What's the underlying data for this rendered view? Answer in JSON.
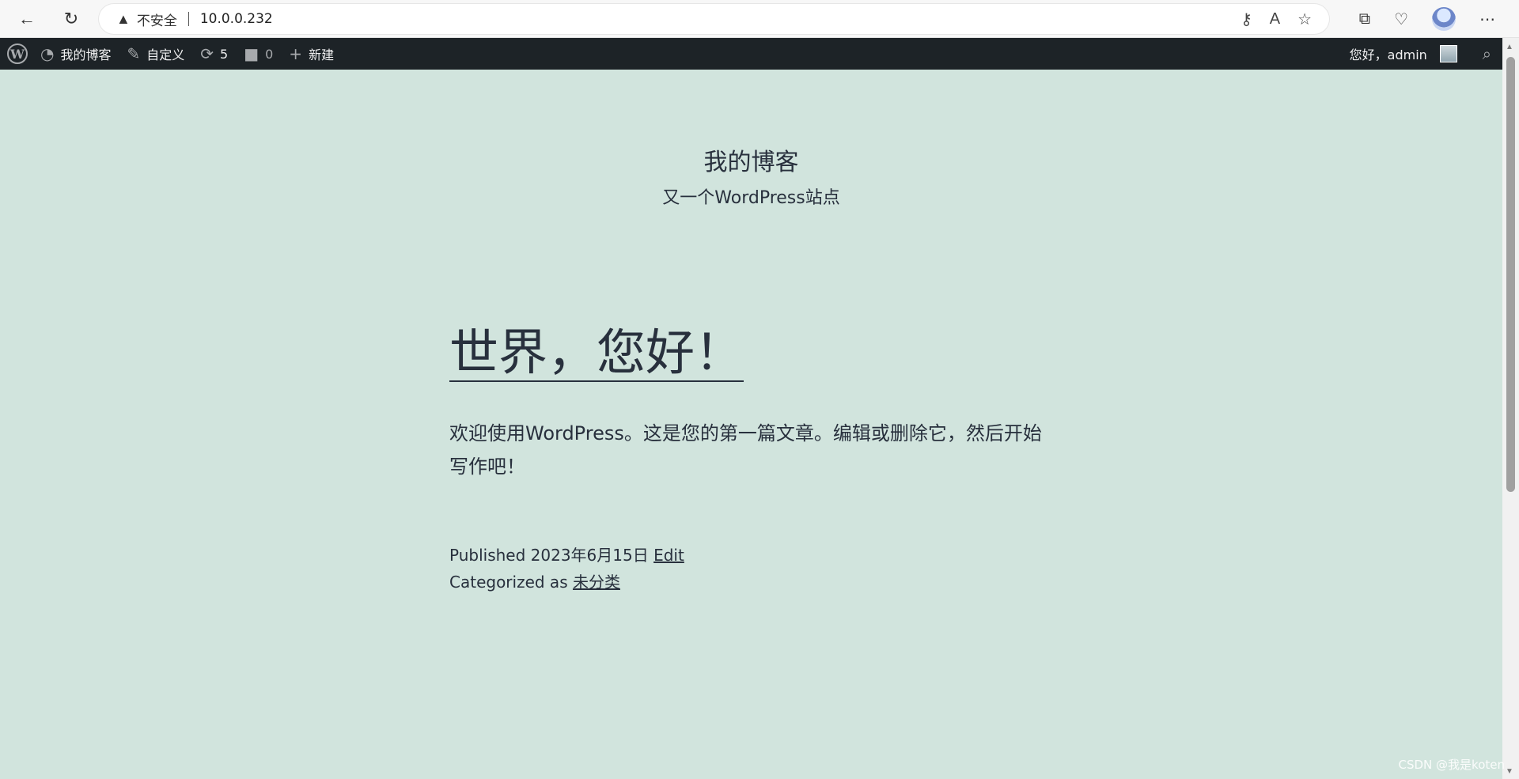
{
  "browser": {
    "security_label": "不安全",
    "url": "10.0.0.232"
  },
  "admin_bar": {
    "site_name": "我的博客",
    "customize": "自定义",
    "updates_count": "5",
    "comments_count": "0",
    "new": "新建",
    "howdy": "您好，admin"
  },
  "site": {
    "title": "我的博客",
    "description": "又一个WordPress站点"
  },
  "post": {
    "title": "世界，您好！",
    "body": "欢迎使用WordPress。这是您的第一篇文章。编辑或删除它，然后开始写作吧！",
    "published_label": "Published",
    "published_date": "2023年6月15日",
    "edit_label": "Edit",
    "categorized_label": "Categorized as",
    "category": "未分类"
  },
  "watermark": "CSDN @我是koten",
  "icons": [
    "back-icon",
    "refresh-icon",
    "warning-icon",
    "key-icon",
    "read-aloud-icon",
    "favorite-star-icon",
    "collections-icon",
    "health-icon",
    "menu-dots-icon",
    "wordpress-logo-icon",
    "dashboard-icon",
    "brush-icon",
    "updates-icon",
    "comment-icon",
    "plus-icon",
    "search-icon"
  ]
}
